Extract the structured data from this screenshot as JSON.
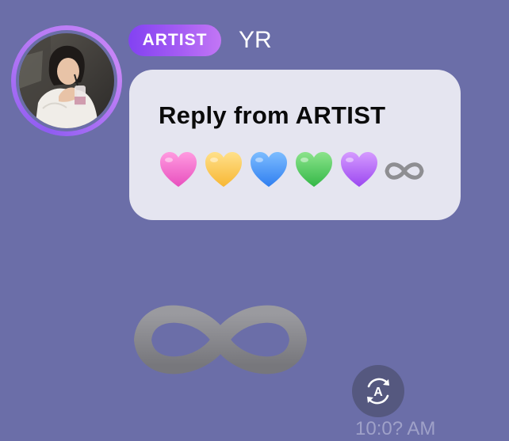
{
  "header": {
    "badge_label": "ARTIST",
    "sender_name": "YR"
  },
  "message": {
    "title": "Reply from ARTIST",
    "emojis": [
      "pink-heart",
      "yellow-heart",
      "blue-heart",
      "green-heart",
      "purple-heart",
      "infinity"
    ],
    "sticker": "infinity"
  },
  "timestamp": "10:0? AM",
  "colors": {
    "background": "#6b6ea8",
    "bubble": "#e5e5f0",
    "badge_gradient_start": "#8342f2",
    "badge_gradient_end": "#c276f5",
    "avatar_ring": "#a66af4",
    "infinity": "#8b8b8f"
  },
  "icons": {
    "translate_button": "translate-icon"
  }
}
